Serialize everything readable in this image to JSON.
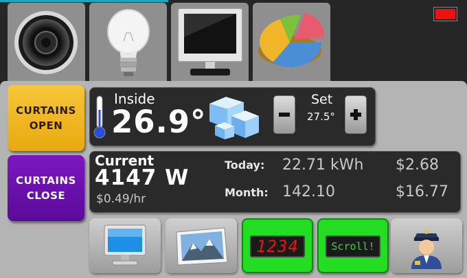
{
  "tabs": [
    {
      "name": "speaker-icon"
    },
    {
      "name": "lightbulb-icon"
    },
    {
      "name": "monitor-icon"
    },
    {
      "name": "pie-chart-icon"
    }
  ],
  "curtains": {
    "open_label": "CURTAINS\nOPEN",
    "close_label": "CURTAINS\nCLOSE"
  },
  "climate": {
    "inside_label": "Inside",
    "inside_temp": "26.9°",
    "set_label": "Set",
    "set_temp": "27.5°"
  },
  "power": {
    "current_label": "Current",
    "current_watts": "4147 W",
    "rate": "$0.49/hr",
    "today_label": "Today:",
    "today_kwh": "22.71 kWh",
    "today_cost": "$2.68",
    "month_label": "Month:",
    "month_kwh": "142.10",
    "month_cost": "$16.77"
  },
  "bottom": {
    "clock_display": "1234",
    "message_display": "Scroll!"
  },
  "colors": {
    "accent_line": "#1aa7c0",
    "close_red": "#ee1111",
    "open_yellow": "#f0b81e",
    "close_purple": "#6a0fb0",
    "led_green": "#22dd22"
  }
}
